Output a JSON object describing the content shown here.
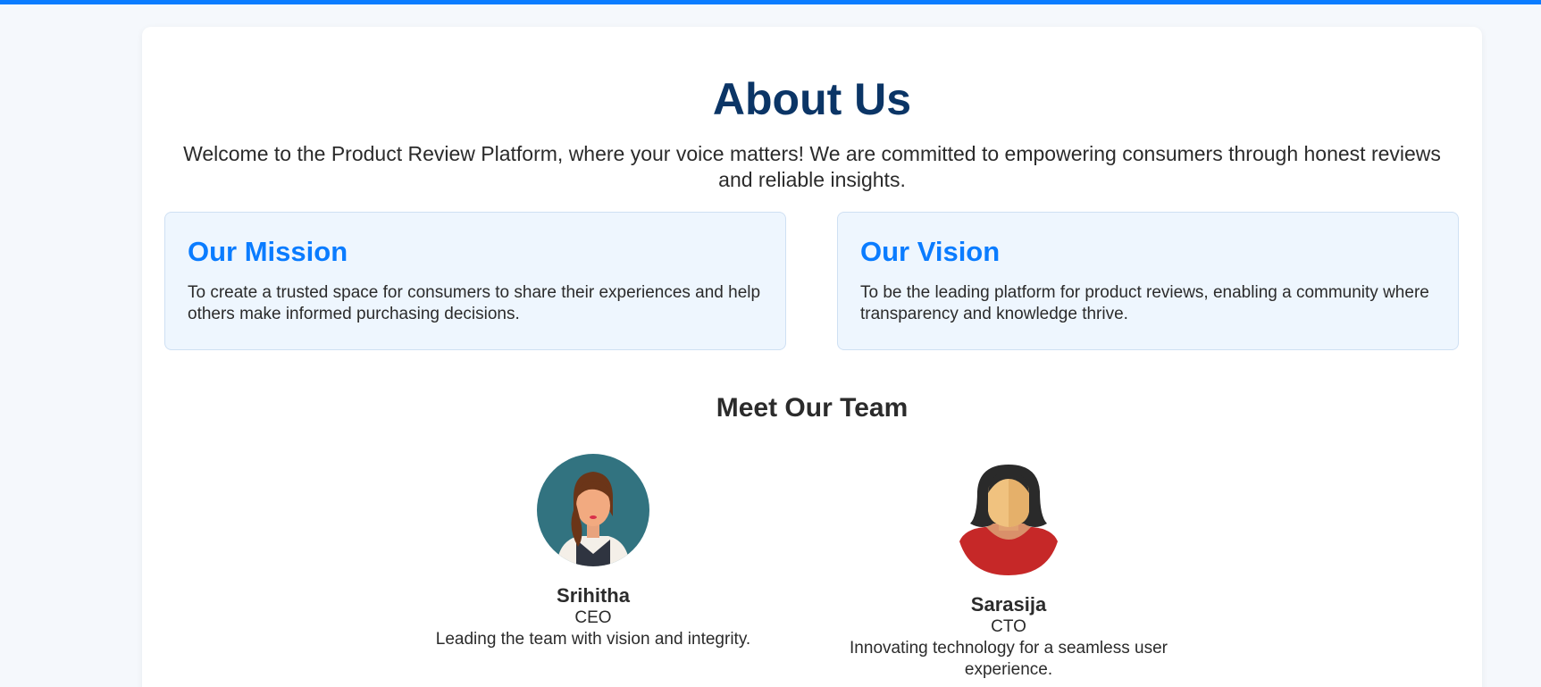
{
  "page": {
    "title": "About Us",
    "intro": "Welcome to the Product Review Platform, where your voice matters! We are committed to empowering consumers through honest reviews and reliable insights."
  },
  "mission": {
    "title": "Our Mission",
    "text": "To create a trusted space for consumers to share their experiences and help others make informed purchasing decisions."
  },
  "vision": {
    "title": "Our Vision",
    "text": "To be the leading platform for product reviews, enabling a community where transparency and knowledge thrive."
  },
  "team": {
    "title": "Meet Our Team",
    "members": [
      {
        "name": "Srihitha",
        "role": "CEO",
        "description": "Leading the team with vision and integrity.",
        "avatar_icon": "woman-avatar-icon"
      },
      {
        "name": "Sarasija",
        "role": "CTO",
        "description": "Innovating technology for a seamless user experience.",
        "avatar_icon": "woman-avatar-icon"
      }
    ]
  },
  "colors": {
    "accent": "#0a7cff",
    "title": "#0b3566",
    "box_background": "#eef6fe"
  }
}
